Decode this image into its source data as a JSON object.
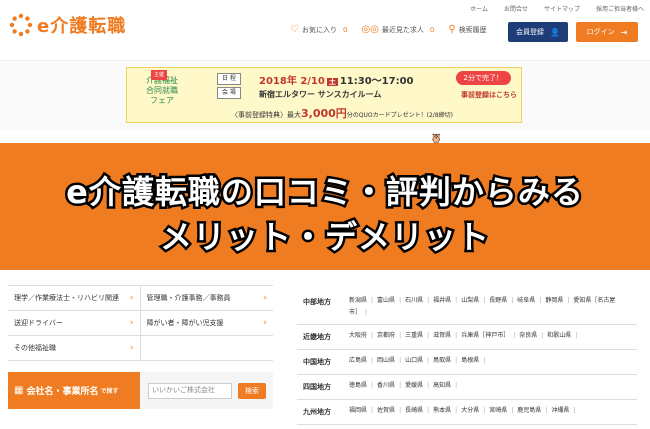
{
  "header": {
    "top_links": [
      "ホーム",
      "お問合せ",
      "サイトマップ",
      "採用ご担当者様へ"
    ],
    "logo_text": "e介護転職",
    "favorites_label": "お気に入り",
    "favorites_count": "0",
    "recent_label": "最近見た求人",
    "recent_count": "0",
    "search_history_label": "検索履歴",
    "member_button": "会員登録",
    "login_button": "ログイン"
  },
  "banner": {
    "left_badge": "主催",
    "left_title_1": "介護福祉",
    "left_title_2": "合同就職",
    "left_title_3": "フェア",
    "tag_date": "日 程",
    "tag_venue": "会 場",
    "date": "2018年 2/10",
    "weekday": "土",
    "time": "11:30～17:00",
    "venue": "新宿エルタワー サンスカイルーム",
    "pre_label": "〈事前登録特典〉最大",
    "pre_amount": "3,000円",
    "pre_rest": "分のQUOカードプレゼント！(2/8締切)",
    "quick": "2分で完了！",
    "register": "事前登録はこちら"
  },
  "hero": {
    "line1": "e介護転職の口コミ・評判からみる",
    "line2": "メリット・デメリット"
  },
  "categories": [
    [
      "理学／作業療法士・リハビリ関連",
      "管理職・介護事務／事務員"
    ],
    [
      "送迎ドライバー",
      "障がい者・障がい児支援"
    ],
    [
      "その他福祉職",
      ""
    ]
  ],
  "search": {
    "label_main": "会社名・事業所名",
    "label_suffix": "で探す",
    "placeholder": "いいかいご株式会社",
    "button": "検索"
  },
  "regions": [
    {
      "name": "中部地方",
      "prefs": [
        "新潟県",
        "富山県",
        "石川県",
        "福井県",
        "山梨県",
        "長野県",
        "岐阜県",
        "静岡県",
        "愛知県［名古屋市］"
      ]
    },
    {
      "name": "近畿地方",
      "prefs": [
        "大阪府",
        "京都府",
        "三重県",
        "滋賀県",
        "兵庫県［神戸市］",
        "奈良県",
        "和歌山県"
      ]
    },
    {
      "name": "中国地方",
      "prefs": [
        "広島県",
        "岡山県",
        "山口県",
        "鳥取県",
        "島根県"
      ]
    },
    {
      "name": "四国地方",
      "prefs": [
        "徳島県",
        "香川県",
        "愛媛県",
        "高知県"
      ]
    },
    {
      "name": "九州地方",
      "prefs": [
        "福岡県",
        "佐賀県",
        "長崎県",
        "熊本県",
        "大分県",
        "宮崎県",
        "鹿児島県",
        "沖縄県"
      ]
    }
  ],
  "colors": {
    "accent": "#ef7c22",
    "navy": "#1d3c78"
  }
}
